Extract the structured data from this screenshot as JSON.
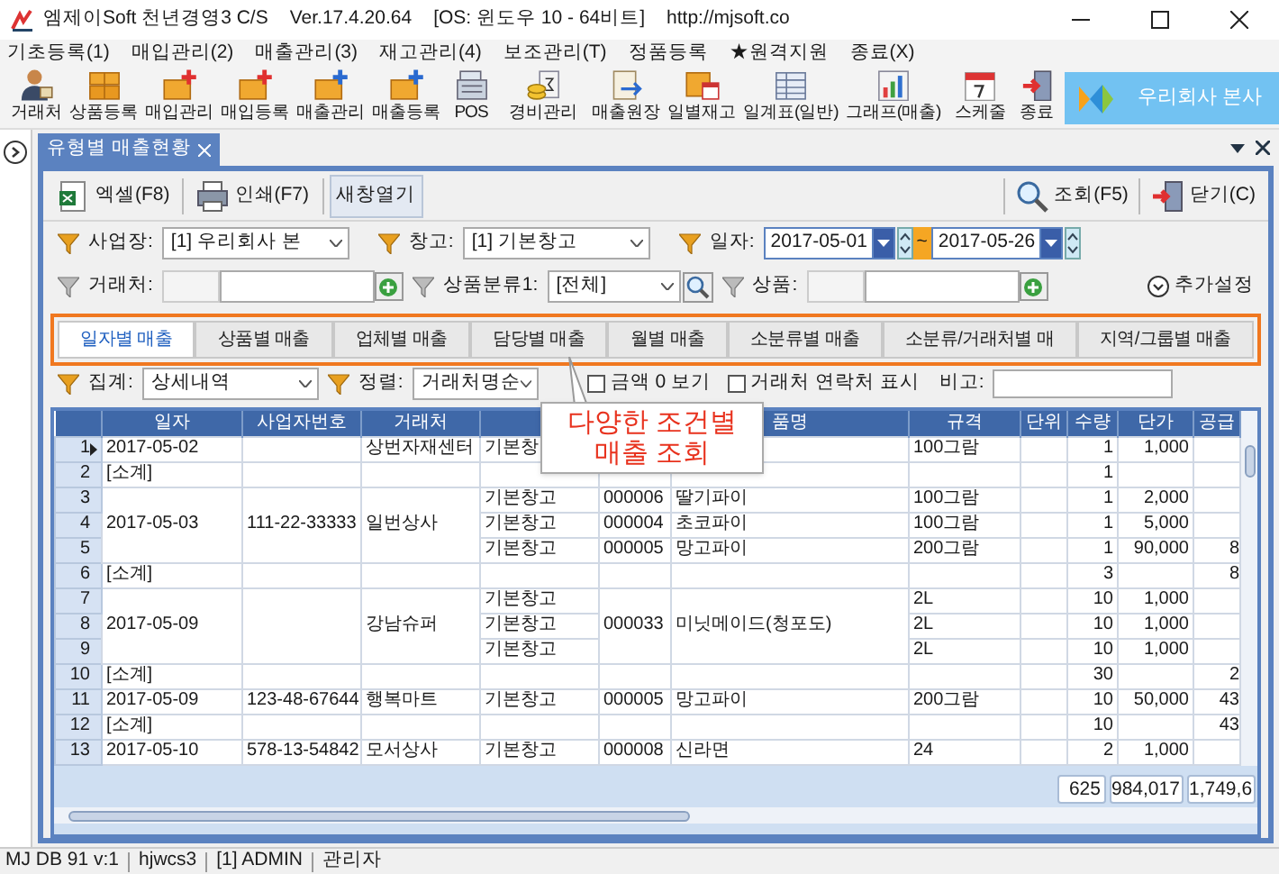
{
  "window": {
    "title": "엠제이Soft 천년경영3 C/S",
    "version": "Ver.17.4.20.64",
    "os": "[OS: 윈도우 10 - 64비트]",
    "url": "http://mjsoft.co"
  },
  "menu": [
    "기초등록(1)",
    "매입관리(2)",
    "매출관리(3)",
    "재고관리(4)",
    "보조관리(T)",
    "정품등록",
    "★원격지원",
    "종료(X)"
  ],
  "toolbar": {
    "groups": [
      [
        "거래처",
        "상품등록",
        "매입관리",
        "매입등록",
        "매출관리",
        "매출등록",
        "POS"
      ],
      [
        "경비관리"
      ],
      [
        "매출원장",
        "일별재고",
        "일계표(일반)",
        "그래프(매출)"
      ],
      [
        "스케줄",
        "종료"
      ]
    ],
    "company": "우리회사 본사"
  },
  "document_tab": {
    "title": "유형별 매출현황"
  },
  "actions": {
    "left": [
      {
        "label": "엑셀(F8)",
        "pressed": false
      },
      {
        "label": "인쇄(F7)",
        "pressed": false
      },
      {
        "label": "새창열기",
        "pressed": true
      }
    ],
    "right": [
      "조회(F5)",
      "닫기(C)"
    ]
  },
  "filters": {
    "site_label": "사업장:",
    "site": "[1] 우리회사 본",
    "warehouse_label": "창고:",
    "warehouse": "[1] 기본창고",
    "date_label": "일자:",
    "date_from": "2017-05-01",
    "date_sep": "~",
    "date_to": "2017-05-26",
    "client_label": "거래처:",
    "category_label": "상품분류1:",
    "category": "[전체]",
    "product_label": "상품:",
    "more": "추가설정"
  },
  "tabs": [
    {
      "label": "일자별 매출",
      "selected": true
    },
    {
      "label": "상품별 매출",
      "selected": false
    },
    {
      "label": "업체별 매출",
      "selected": false
    },
    {
      "label": "담당별 매출",
      "selected": false
    },
    {
      "label": "월별 매출",
      "selected": false
    },
    {
      "label": "소분류별 매출",
      "selected": false
    },
    {
      "label": "소분류/거래처별 매",
      "selected": false
    },
    {
      "label": "지역/그룹별 매출",
      "selected": false
    }
  ],
  "options": {
    "group_label": "집계:",
    "group": "상세내역",
    "sort_label": "정렬:",
    "sort": "거래처명순",
    "checks": [
      {
        "label": "금액 0 보기",
        "checked": false
      },
      {
        "label": "거래처 연락처 표시",
        "checked": false
      }
    ],
    "note_label": "비고:"
  },
  "callout": [
    "다양한 조건별",
    "매출 조회"
  ],
  "table": {
    "columns": [
      "일자",
      "사업자번호",
      "거래처",
      null,
      null,
      "품명",
      "규격",
      "단위",
      "수량",
      "단가",
      "공급"
    ],
    "groups": [
      {
        "date": "2017-05-02",
        "client": "상번자재센터",
        "lines": [
          {
            "no": "1",
            "selected": true,
            "warehouse": "기본창",
            "spec": "100그람",
            "qty": "1",
            "price": "1,000"
          }
        ],
        "subtotal": {
          "no": "2",
          "selected": false,
          "label": "[소계]",
          "qty": "1"
        }
      },
      {
        "date": "2017-05-03",
        "biz_no": "111-22-33333",
        "client": "일번상사",
        "lines": [
          {
            "no": "3",
            "selected": false,
            "warehouse": "기본창고",
            "code": "000006",
            "name": "딸기파이",
            "spec": "100그람",
            "qty": "1",
            "price": "2,000"
          },
          {
            "no": "4",
            "selected": false,
            "warehouse": "기본창고",
            "code": "000004",
            "name": "초코파이",
            "spec": "100그람",
            "qty": "1",
            "price": "5,000"
          },
          {
            "no": "5",
            "selected": false,
            "warehouse": "기본창고",
            "code": "000005",
            "name": "망고파이",
            "spec": "200그람",
            "qty": "1",
            "price": "90,000",
            "supply": "8"
          }
        ],
        "subtotal": {
          "no": "6",
          "selected": false,
          "label": "[소계]",
          "qty": "3",
          "supply": "8"
        }
      },
      {
        "date": "2017-05-09",
        "client": "강남슈퍼",
        "item": {
          "code": "000033",
          "name": "미닛메이드(청포도)"
        },
        "lines": [
          {
            "no": "7",
            "selected": false,
            "warehouse": "기본창고",
            "spec": "2L",
            "qty": "10",
            "price": "1,000"
          },
          {
            "no": "8",
            "selected": false,
            "warehouse": "기본창고",
            "spec": "2L",
            "qty": "10",
            "price": "1,000"
          },
          {
            "no": "9",
            "selected": false,
            "warehouse": "기본창고",
            "spec": "2L",
            "qty": "10",
            "price": "1,000"
          }
        ],
        "subtotal": {
          "no": "10",
          "selected": false,
          "label": "[소계]",
          "qty": "30",
          "supply": "2"
        }
      },
      {
        "date": "2017-05-09",
        "biz_no": "123-48-67644",
        "client": "행복마트",
        "lines": [
          {
            "no": "11",
            "selected": false,
            "warehouse": "기본창고",
            "code": "000005",
            "name": "망고파이",
            "spec": "200그람",
            "qty": "10",
            "price": "50,000",
            "supply": "43"
          }
        ],
        "subtotal": {
          "no": "12",
          "selected": false,
          "label": "[소계]",
          "qty": "10",
          "supply": "43"
        }
      },
      {
        "date": "2017-05-10",
        "biz_no": "578-13-54842",
        "client": "모서상사",
        "lines": [
          {
            "no": "13",
            "selected": false,
            "warehouse": "기본창고",
            "code": "000008",
            "name": "신라면",
            "spec": "24",
            "qty": "2",
            "price": "1,000"
          }
        ]
      }
    ],
    "totals": [
      "625",
      "984,017",
      "1,749,6"
    ]
  },
  "status_bar": [
    "MJ DB 91 v:1",
    "hjwcs3",
    "[1] ADMIN",
    "관리자"
  ]
}
